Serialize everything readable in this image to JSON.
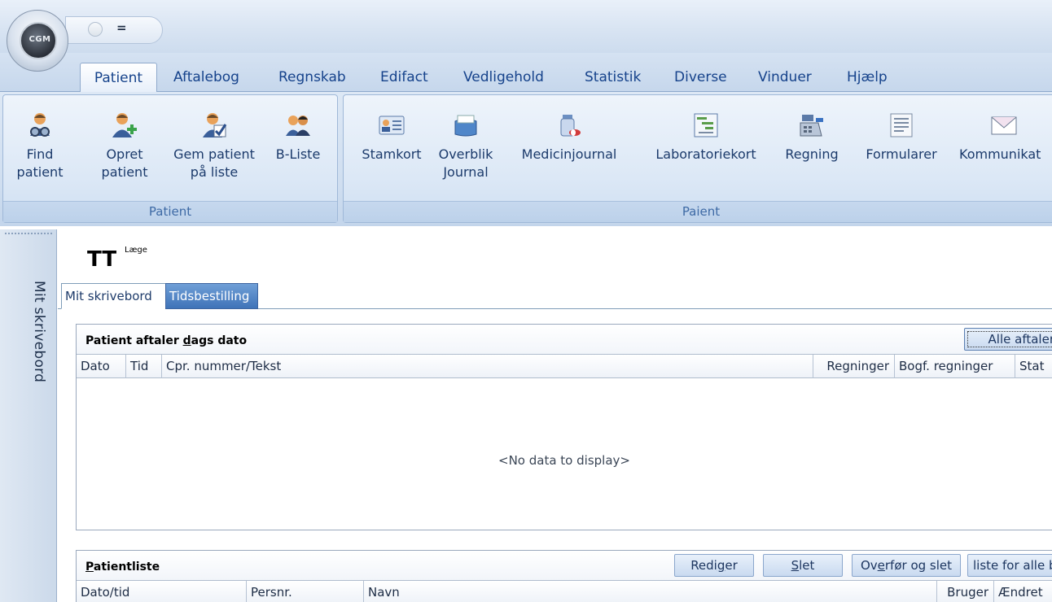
{
  "app": {
    "orb_label": "CGM",
    "qat_dropdown": "="
  },
  "ribbon_tabs": [
    "Patient",
    "Aftalebog",
    "Regnskab",
    "Edifact",
    "Vedligehold",
    "Statistik",
    "Diverse",
    "Vinduer",
    "Hjælp"
  ],
  "ribbon_groups": {
    "patient": {
      "label": "Patient",
      "buttons": [
        {
          "line1": "Find",
          "line2": "patient",
          "icon": "find-patient-icon"
        },
        {
          "line1": "Opret",
          "line2": "patient",
          "icon": "add-patient-icon"
        },
        {
          "line1": "Gem patient",
          "line2": "på liste",
          "icon": "save-patient-list-icon"
        },
        {
          "line1": "B-Liste",
          "line2": "",
          "icon": "group-patients-icon"
        }
      ]
    },
    "paient": {
      "label": "Paient",
      "buttons": [
        {
          "line1": "Stamkort",
          "line2": "",
          "icon": "id-card-icon"
        },
        {
          "line1": "Overblik",
          "line2": "Journal",
          "icon": "journal-box-icon"
        },
        {
          "line1": "Medicinjournal",
          "line2": "",
          "icon": "medicine-bottle-icon"
        },
        {
          "line1": "Laboratoriekort",
          "line2": "",
          "icon": "lab-chart-icon"
        },
        {
          "line1": "Regning",
          "line2": "",
          "icon": "cash-register-icon"
        },
        {
          "line1": "Formularer",
          "line2": "",
          "icon": "form-document-icon"
        },
        {
          "line1": "Kommunikat",
          "line2": "",
          "icon": "envelope-icon"
        }
      ]
    }
  },
  "sidebar": {
    "label": "Mit skrivebord"
  },
  "user": {
    "initials": "TT",
    "role": "Læge"
  },
  "doc_tabs": [
    "Mit skrivebord",
    "Tidsbestilling"
  ],
  "appointments": {
    "title_pre": "Patient aftaler ",
    "title_underline": "d",
    "title_post": "ags dato",
    "button": "Alle aftaler",
    "columns": [
      "Dato",
      "Tid",
      "Cpr. nummer/Tekst",
      "Regninger",
      "Bogf. regninger",
      "Stat"
    ],
    "empty_text": "<No data to display>"
  },
  "patientlist": {
    "title_underline": "P",
    "title_post": "atientliste",
    "buttons": {
      "edit_pre": "Redi",
      "edit_u": "g",
      "edit_post": "er",
      "delete_u": "S",
      "delete_post": "let",
      "move_pre": "Ov",
      "move_u": "e",
      "move_post": "rfør og slet",
      "all": "liste for alle b"
    },
    "columns": [
      "Dato/tid",
      "Persnr.",
      "Navn",
      "Bruger",
      "Ændret"
    ]
  },
  "colors": {
    "accent": "#15428b",
    "active_tab": "#3f73b8"
  }
}
